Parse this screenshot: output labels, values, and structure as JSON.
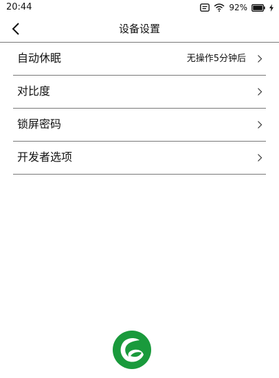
{
  "status_bar": {
    "time": "20:44",
    "battery_percent": "92%",
    "icons": [
      "notification-icon",
      "wifi-icon",
      "battery-icon",
      "charging-icon"
    ]
  },
  "header": {
    "title": "设备设置",
    "back_icon": "chevron-left-icon"
  },
  "settings": [
    {
      "label": "自动休眠",
      "value": "无操作5分钟后"
    },
    {
      "label": "对比度",
      "value": ""
    },
    {
      "label": "锁屏密码",
      "value": ""
    },
    {
      "label": "开发者选项",
      "value": ""
    }
  ],
  "colors": {
    "brand_green": "#1a9a3c",
    "divider": "#777777",
    "text": "#111111"
  }
}
